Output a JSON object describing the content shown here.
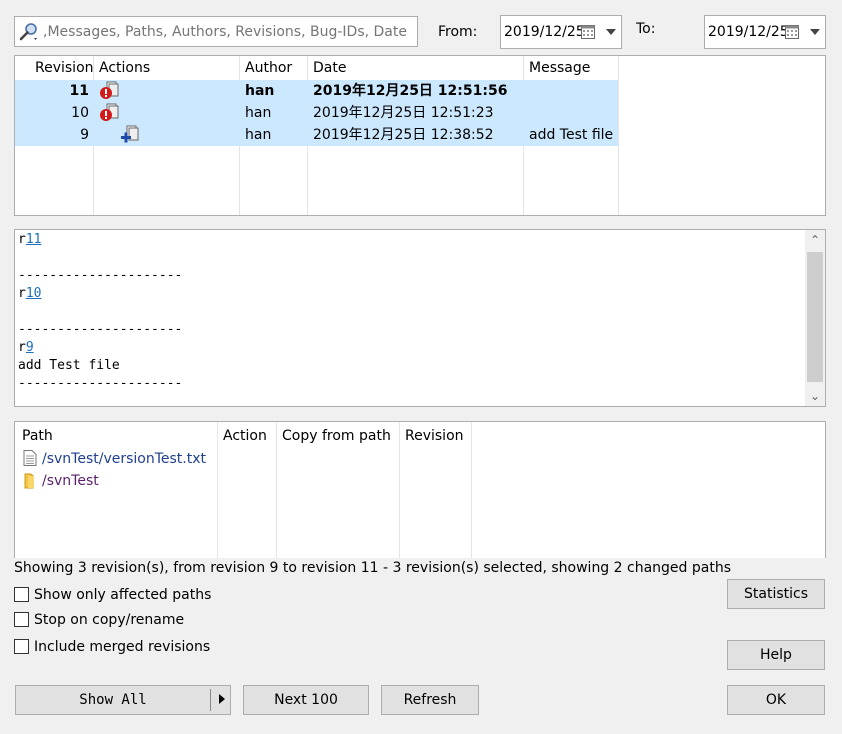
{
  "search": {
    "placeholder": "Messages, Paths, Authors, Revisions, Bug-IDs, Date,"
  },
  "from": {
    "label": "From:",
    "value": "2019/12/25"
  },
  "to": {
    "label": "To:",
    "value": "2019/12/25"
  },
  "revisions": {
    "headers": [
      "Revision",
      "Actions",
      "Author",
      "Date",
      "Message"
    ],
    "rows": [
      {
        "revision": "11",
        "author": "han",
        "date": "2019年12月25日 12:51:56",
        "message": ""
      },
      {
        "revision": "10",
        "author": "han",
        "date": "2019年12月25日 12:51:23",
        "message": ""
      },
      {
        "revision": "9",
        "author": "han",
        "date": "2019年12月25日 12:38:52",
        "message": "add Test file"
      }
    ]
  },
  "message_panel": {
    "entries": [
      {
        "prefix": "r",
        "rev": "11",
        "text": "",
        "sep": "---------------------"
      },
      {
        "prefix": "r",
        "rev": "10",
        "text": "",
        "sep": "---------------------"
      },
      {
        "prefix": "r",
        "rev": "9",
        "text": "add Test file",
        "sep": "---------------------"
      }
    ]
  },
  "paths": {
    "headers": [
      "Path",
      "Action",
      "Copy from path",
      "Revision"
    ],
    "rows": [
      {
        "path": "/svnTest/versionTest.txt",
        "icon": "file-icon",
        "color": "#1f3f8f"
      },
      {
        "path": "/svnTest",
        "icon": "folder-icon",
        "color": "#5a1f6a"
      }
    ]
  },
  "status_text": "Showing 3 revision(s), from revision 9 to revision 11 - 3 revision(s) selected, showing 2 changed paths",
  "options": {
    "affected": "Show only affected paths",
    "stop_copy": "Stop on copy/rename",
    "merged": "Include merged revisions"
  },
  "buttons": {
    "statistics": "Statistics",
    "help": "Help",
    "show_all": "Show All",
    "next100": "Next 100",
    "refresh": "Refresh",
    "ok": "OK"
  },
  "colors": {
    "selection": "#cce8ff",
    "link": "#1a6fbf"
  }
}
